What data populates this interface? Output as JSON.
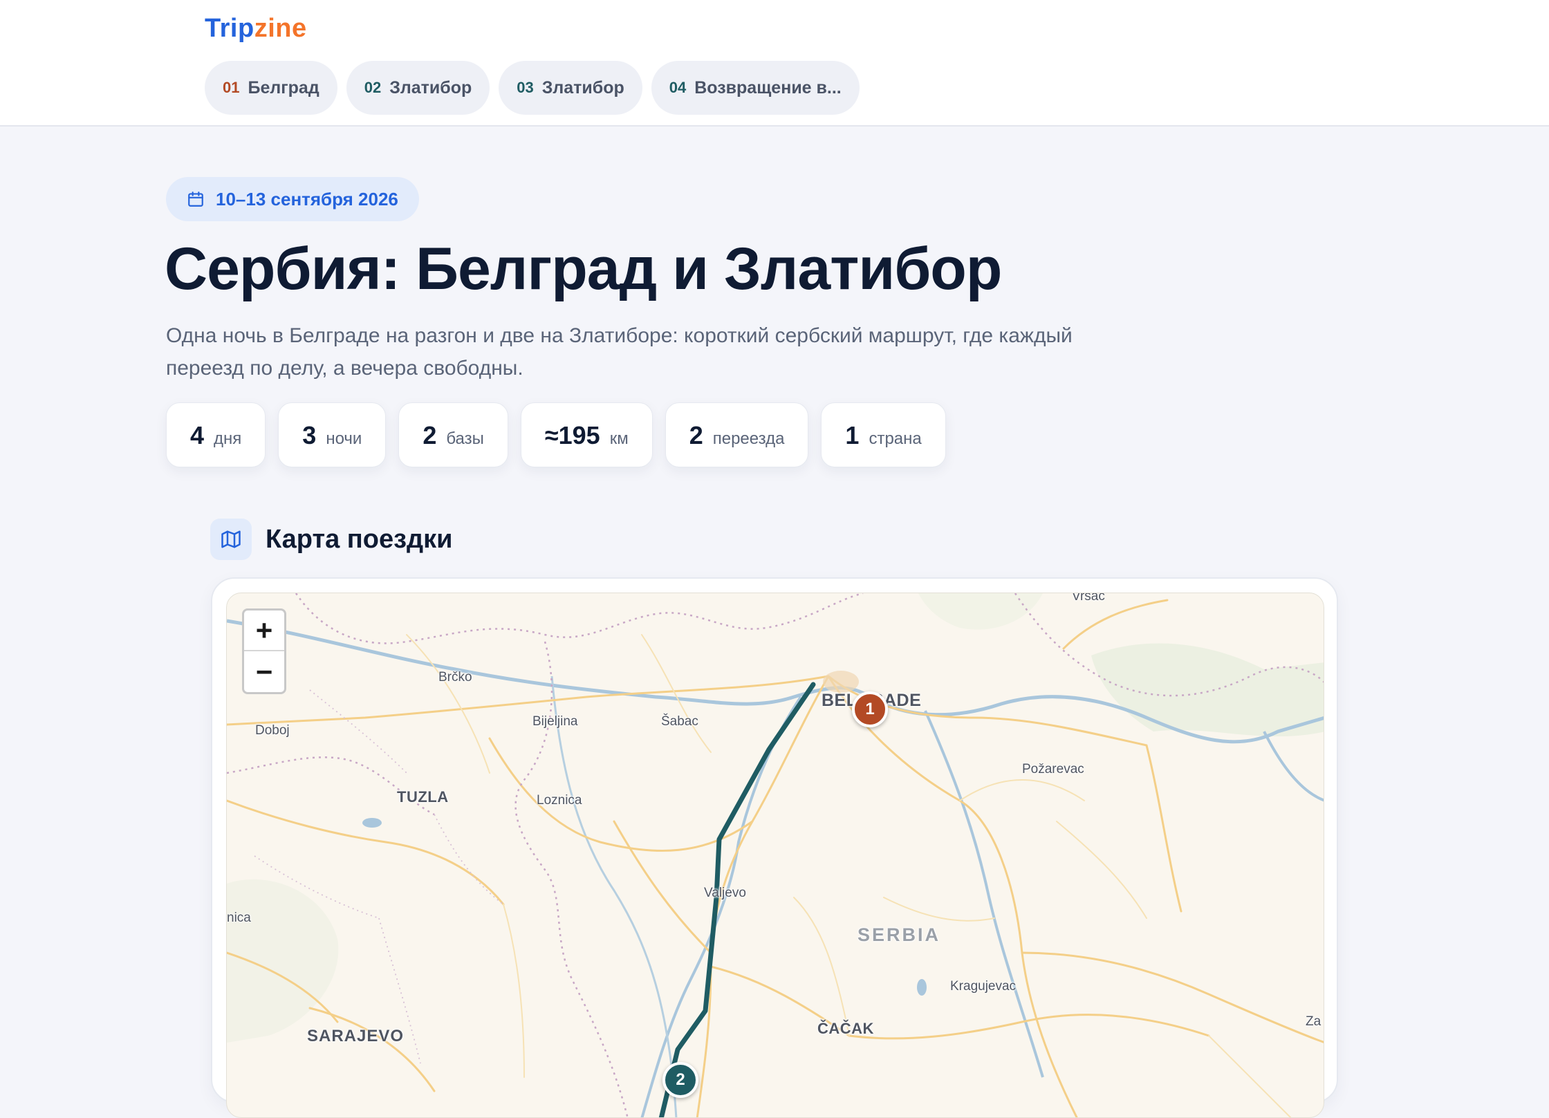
{
  "brand": {
    "part1": "Trip",
    "part2": "zine"
  },
  "day_tabs": [
    {
      "num": "01",
      "label": "Белград",
      "num_color": "#b34a25"
    },
    {
      "num": "02",
      "label": "Златибор",
      "num_color": "#1f5c63"
    },
    {
      "num": "03",
      "label": "Златибор",
      "num_color": "#1f5c63"
    },
    {
      "num": "04",
      "label": "Возвращение в...",
      "num_color": "#1f5c63"
    }
  ],
  "hero": {
    "dates": "10–13 сентября 2026",
    "title": "Сербия: Белград и Златибор",
    "lede": "Одна ночь в Белграде на разгон и две на Златиборе: короткий сербский маршрут, где каждый переезд по делу, а вечера свободны."
  },
  "stats": [
    {
      "value": "4",
      "unit": "дня"
    },
    {
      "value": "3",
      "unit": "ночи"
    },
    {
      "value": "2",
      "unit": "базы"
    },
    {
      "value": "≈195",
      "unit": "км"
    },
    {
      "value": "2",
      "unit": "переезда"
    },
    {
      "value": "1",
      "unit": "страна"
    }
  ],
  "map_section": {
    "title": "Карта поездки",
    "zoom_in": "+",
    "zoom_out": "−",
    "route_color": "#1f5c63",
    "labels": {
      "vrsac": "Vršac",
      "brcko": "Brčko",
      "belgrade": "BELGRADE",
      "doboj": "Doboj",
      "bijeljina": "Bijeljina",
      "sabac": "Šabac",
      "pozarevac": "Požarevac",
      "tuzla": "TUZLA",
      "loznica": "Loznica",
      "valjevo": "Valjevo",
      "zenica": "nica",
      "serbia": "SERBIA",
      "kragujevac": "Kragujevac",
      "sarajevo": "SARAJEVO",
      "cacak": "ČAČAK",
      "za": "Za"
    },
    "markers": [
      {
        "num": "1",
        "color": "#b34a25"
      },
      {
        "num": "2",
        "color": "#1f5c63"
      }
    ]
  }
}
